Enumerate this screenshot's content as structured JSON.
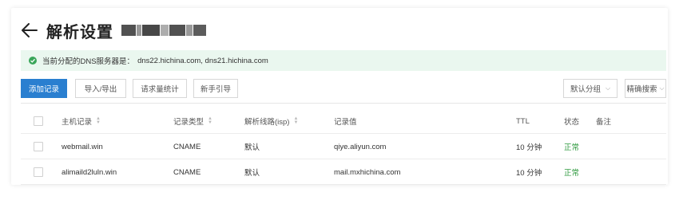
{
  "header": {
    "title": "解析设置"
  },
  "notice": {
    "label": "当前分配的DNS服务器是：",
    "servers": "dns22.hichina.com, dns21.hichina.com"
  },
  "toolbar": {
    "add_record": "添加记录",
    "import_export": "导入/导出",
    "request_stats": "请求量统计",
    "guide": "新手引导",
    "default_group": "默认分组",
    "advanced_search": "精确搜索"
  },
  "table": {
    "columns": {
      "host": "主机记录",
      "type": "记录类型",
      "line": "解析线路(isp)",
      "value": "记录值",
      "ttl": "TTL",
      "status": "状态",
      "remark": "备注"
    },
    "rows": [
      {
        "host": "webmail.win",
        "type": "CNAME",
        "line": "默认",
        "value": "qiye.aliyun.com",
        "ttl": "10 分钟",
        "status": "正常"
      },
      {
        "host": "alimaild2luln.win",
        "type": "CNAME",
        "line": "默认",
        "value": "mail.mxhichina.com",
        "ttl": "10 分钟",
        "status": "正常"
      }
    ]
  },
  "colors": {
    "primary": "#2a7fd0",
    "notice_bg": "#eaf7ef",
    "success": "#3aa65a",
    "status_text": "#2f9a3f"
  }
}
